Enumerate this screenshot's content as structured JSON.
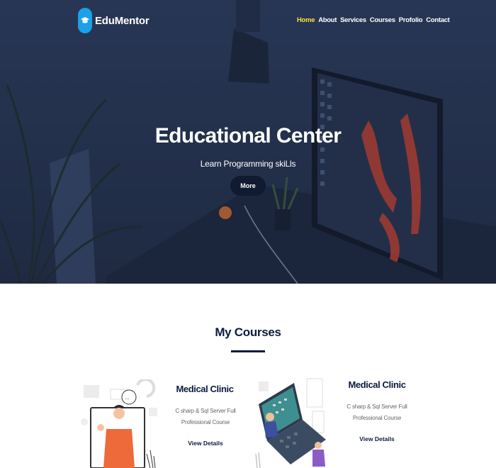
{
  "brand": {
    "name": "EduMentor",
    "accent": "#1ca0e8"
  },
  "nav": {
    "items": [
      "Home",
      "About",
      "Services",
      "Courses",
      "Profolio",
      "Contact"
    ],
    "active_color": "#f5e33b"
  },
  "hero": {
    "title": "Educational Center",
    "subtitle": "Learn Programming skiLls",
    "button": "More"
  },
  "courses": {
    "heading": "My Courses",
    "cards": [
      {
        "title": "Medical Clinic",
        "description": "C sharp & Sql Server Full Professional Course",
        "link": "View Details"
      },
      {
        "title": "Medical Clinic",
        "description": "C sharp & Sql Server Full Professional Course",
        "link": "View Details"
      }
    ]
  }
}
